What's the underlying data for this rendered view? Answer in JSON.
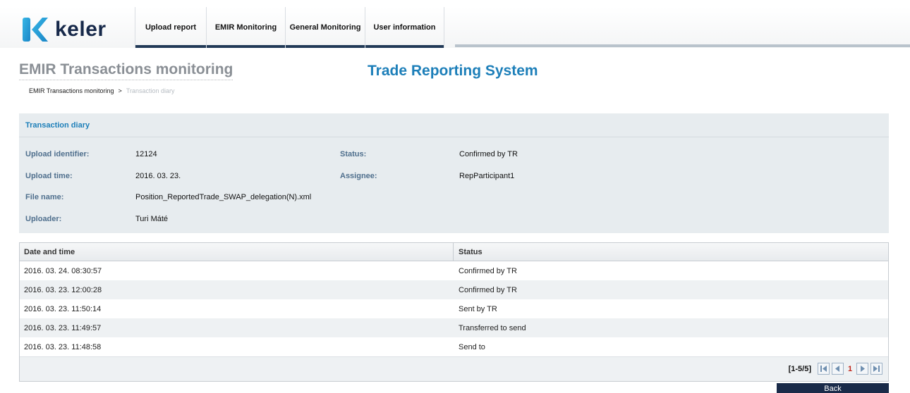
{
  "header": {
    "logo_text": "keler",
    "nav": [
      "Upload report",
      "EMIR Monitoring",
      "General Monitoring",
      "User information"
    ]
  },
  "page": {
    "title": "EMIR Transactions monitoring",
    "system_title": "Trade Reporting System",
    "breadcrumb": {
      "parent": "EMIR Transactions monitoring",
      "separator": ">",
      "current": "Transaction diary"
    }
  },
  "details": {
    "header": "Transaction diary",
    "upload_identifier": {
      "label": "Upload identifier:",
      "value": "12124"
    },
    "upload_time": {
      "label": "Upload time:",
      "value": "2016. 03. 23."
    },
    "file_name": {
      "label": "File name:",
      "value": "Position_ReportedTrade_SWAP_delegation(N).xml"
    },
    "uploader": {
      "label": "Uploader:",
      "value": "Turi Máté"
    },
    "status": {
      "label": "Status:",
      "value": "Confirmed by TR"
    },
    "assignee": {
      "label": "Assignee:",
      "value": "RepParticipant1"
    }
  },
  "table": {
    "columns": [
      "Date and time",
      "Status"
    ],
    "rows": [
      [
        "2016. 03. 24. 08:30:57",
        "Confirmed by TR"
      ],
      [
        "2016. 03. 23. 12:00:28",
        "Confirmed by TR"
      ],
      [
        "2016. 03. 23. 11:50:14",
        "Sent by TR"
      ],
      [
        "2016. 03. 23. 11:49:57",
        "Transferred to send"
      ],
      [
        "2016. 03. 23. 11:48:58",
        "Send to"
      ]
    ],
    "pager": {
      "info": "[1-5/5]",
      "current_page": "1"
    }
  },
  "actions": {
    "back": "Back"
  },
  "colors": {
    "brand_blue": "#1d7fb9",
    "navy": "#1a2b49",
    "panel_bg": "#e7ecef",
    "page_number": "#c0261b"
  }
}
